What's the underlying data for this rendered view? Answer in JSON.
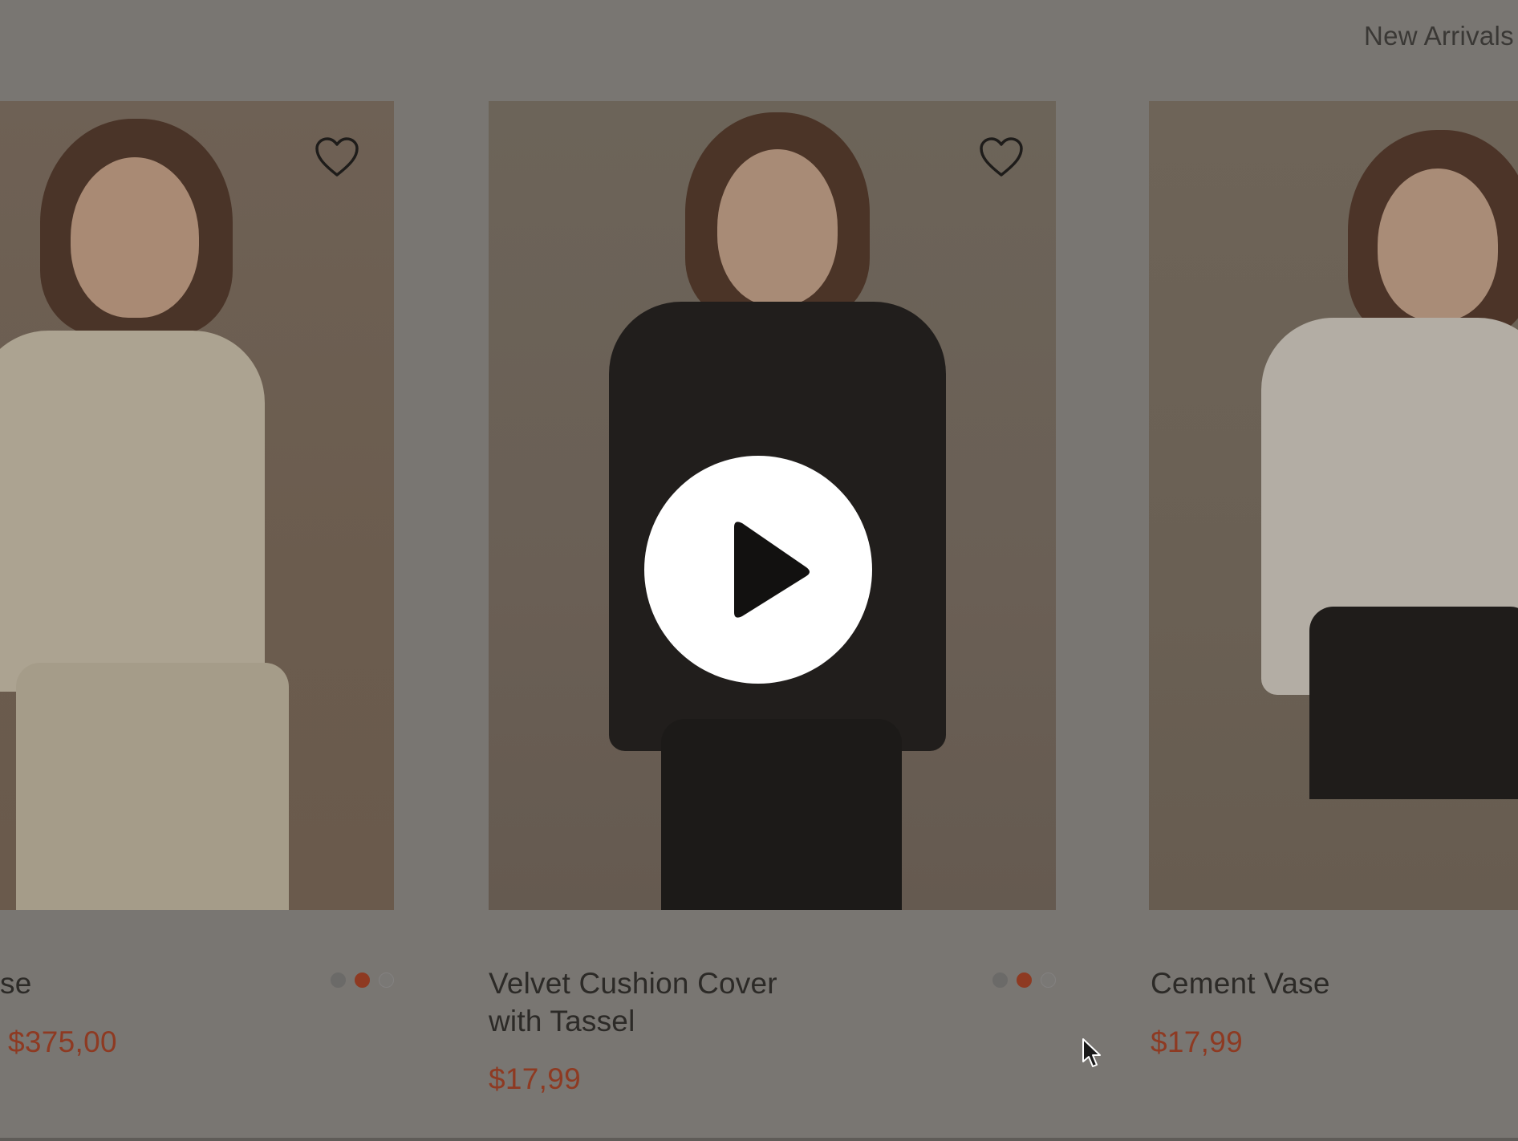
{
  "header": {
    "nav_link": "New Arrivals"
  },
  "products": [
    {
      "title": "se",
      "price": "$375,00",
      "image": "woman-cream-sweatshirt-photo",
      "swatches": [
        "#6b6a68",
        "#8e3a22",
        "#7a7875"
      ],
      "selected_swatch": 1
    },
    {
      "title": "Velvet Cushion Cover with Tassel",
      "price": "$17,99",
      "image": "woman-black-sweatshirt-photo",
      "swatches": [
        "#6b6a68",
        "#8e3a22",
        "#7a7875"
      ],
      "selected_swatch": 1
    },
    {
      "title": "Cement Vase",
      "price": "$17,99",
      "image": "woman-white-tshirt-photo"
    }
  ],
  "overlay": {
    "play_icon": "play-icon"
  },
  "colors": {
    "overlay_background": "#797672",
    "price": "#8e3a22",
    "title": "#2c2a27"
  }
}
